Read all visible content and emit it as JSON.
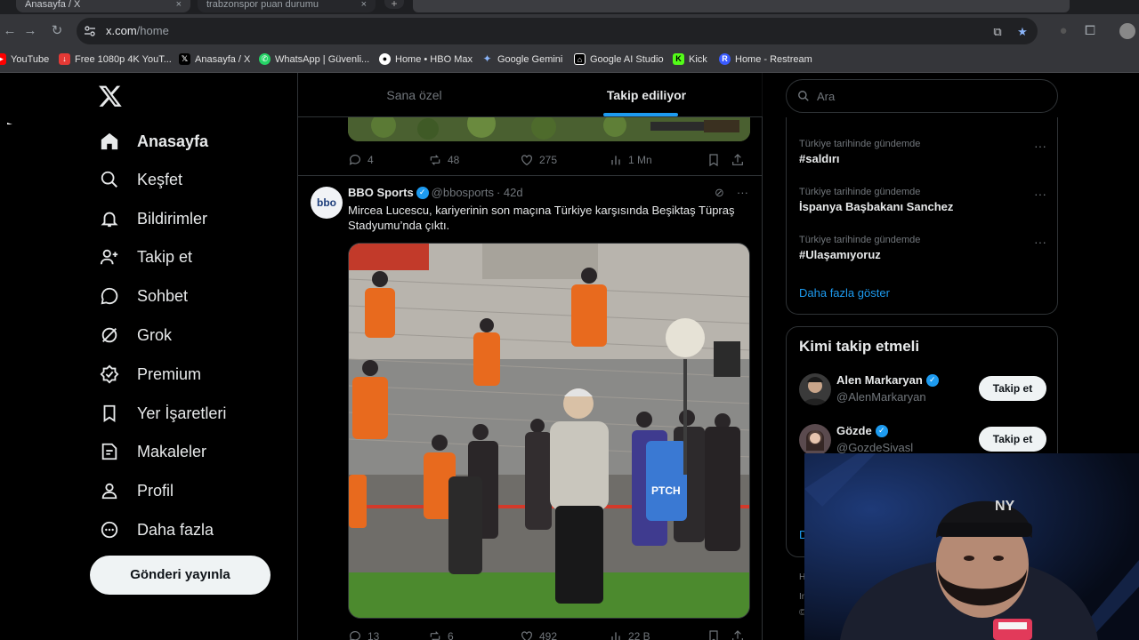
{
  "browser": {
    "tabs": [
      {
        "title": "Anasayfa / X",
        "active": true
      },
      {
        "title": "trabzonspor puan durumu",
        "active": false
      }
    ],
    "url_host": "x.com",
    "url_path": "/home",
    "bookmarks": [
      {
        "label": "YouTube",
        "icon": "youtube-icon",
        "color": "#ff0000"
      },
      {
        "label": "Free 1080p 4K YouT...",
        "icon": "download-icon",
        "color": "#e53935"
      },
      {
        "label": "Anasayfa / X",
        "icon": "x-icon",
        "color": "#000000"
      },
      {
        "label": "WhatsApp | Güvenli...",
        "icon": "whatsapp-icon",
        "color": "#25d366"
      },
      {
        "label": "Home • HBO Max",
        "icon": "hbo-icon",
        "color": "#ffffff"
      },
      {
        "label": "Google Gemini",
        "icon": "gemini-icon",
        "color": "#8ab4f8"
      },
      {
        "label": "Google AI Studio",
        "icon": "ai-studio-icon",
        "color": "#ffffff"
      },
      {
        "label": "Kick",
        "icon": "kick-icon",
        "color": "#53fc18"
      },
      {
        "label": "Home - Restream",
        "icon": "restream-icon",
        "color": "#3a5bff"
      }
    ]
  },
  "sidebar": {
    "items": [
      {
        "label": "Anasayfa",
        "icon": "home-icon"
      },
      {
        "label": "Keşfet",
        "icon": "search-icon"
      },
      {
        "label": "Bildirimler",
        "icon": "bell-icon"
      },
      {
        "label": "Takip et",
        "icon": "follow-icon"
      },
      {
        "label": "Sohbet",
        "icon": "chat-icon"
      },
      {
        "label": "Grok",
        "icon": "grok-icon"
      },
      {
        "label": "Premium",
        "icon": "premium-icon"
      },
      {
        "label": "Yer İşaretleri",
        "icon": "bookmark-icon"
      },
      {
        "label": "Makaleler",
        "icon": "articles-icon"
      },
      {
        "label": "Profil",
        "icon": "profile-icon"
      },
      {
        "label": "Daha fazla",
        "icon": "more-icon"
      }
    ],
    "post_button": "Gönderi yayınla"
  },
  "timeline": {
    "tabs": [
      "Sana özel",
      "Takip ediliyor"
    ],
    "selected_tab": 1,
    "prev_tweet_stats": {
      "replies": "4",
      "reposts": "48",
      "likes": "275",
      "views": "1 Mn"
    },
    "tweet": {
      "avatar_text": "bbo",
      "name": "BBO Sports",
      "handle": "@bbosports",
      "age": "· 42d",
      "text": "Mircea Lucescu, kariyerinin son maçına Türkiye karşısında Beşiktaş Tüpraş Stadyumu’nda çıktı.",
      "stats": {
        "replies": "13",
        "reposts": "6",
        "likes": "492",
        "views": "22 B"
      }
    }
  },
  "right": {
    "search_placeholder": "Ara",
    "trends": [
      {
        "context": "Türkiye tarihinde gündemde",
        "topic": "#saldırı"
      },
      {
        "context": "Türkiye tarihinde gündemde",
        "topic": "İspanya Başbakanı Sanchez"
      },
      {
        "context": "Türkiye tarihinde gündemde",
        "topic": "#Ulaşamıyoruz"
      }
    ],
    "show_more": "Daha fazla göster",
    "who_to_follow_title": "Kimi takip etmeli",
    "who_to_follow": [
      {
        "name": "Alen Markaryan",
        "handle": "@AlenMarkaryan",
        "button": "Takip et"
      },
      {
        "name": "Gözde",
        "handle": "@GozdeSivasl",
        "button": "Takip et"
      }
    ],
    "footer_fragments": [
      "D",
      "H",
      "In",
      "©"
    ]
  },
  "colors": {
    "accent": "#1d9bf0",
    "background": "#000000",
    "border": "#2f3336",
    "muted": "#71767b"
  }
}
